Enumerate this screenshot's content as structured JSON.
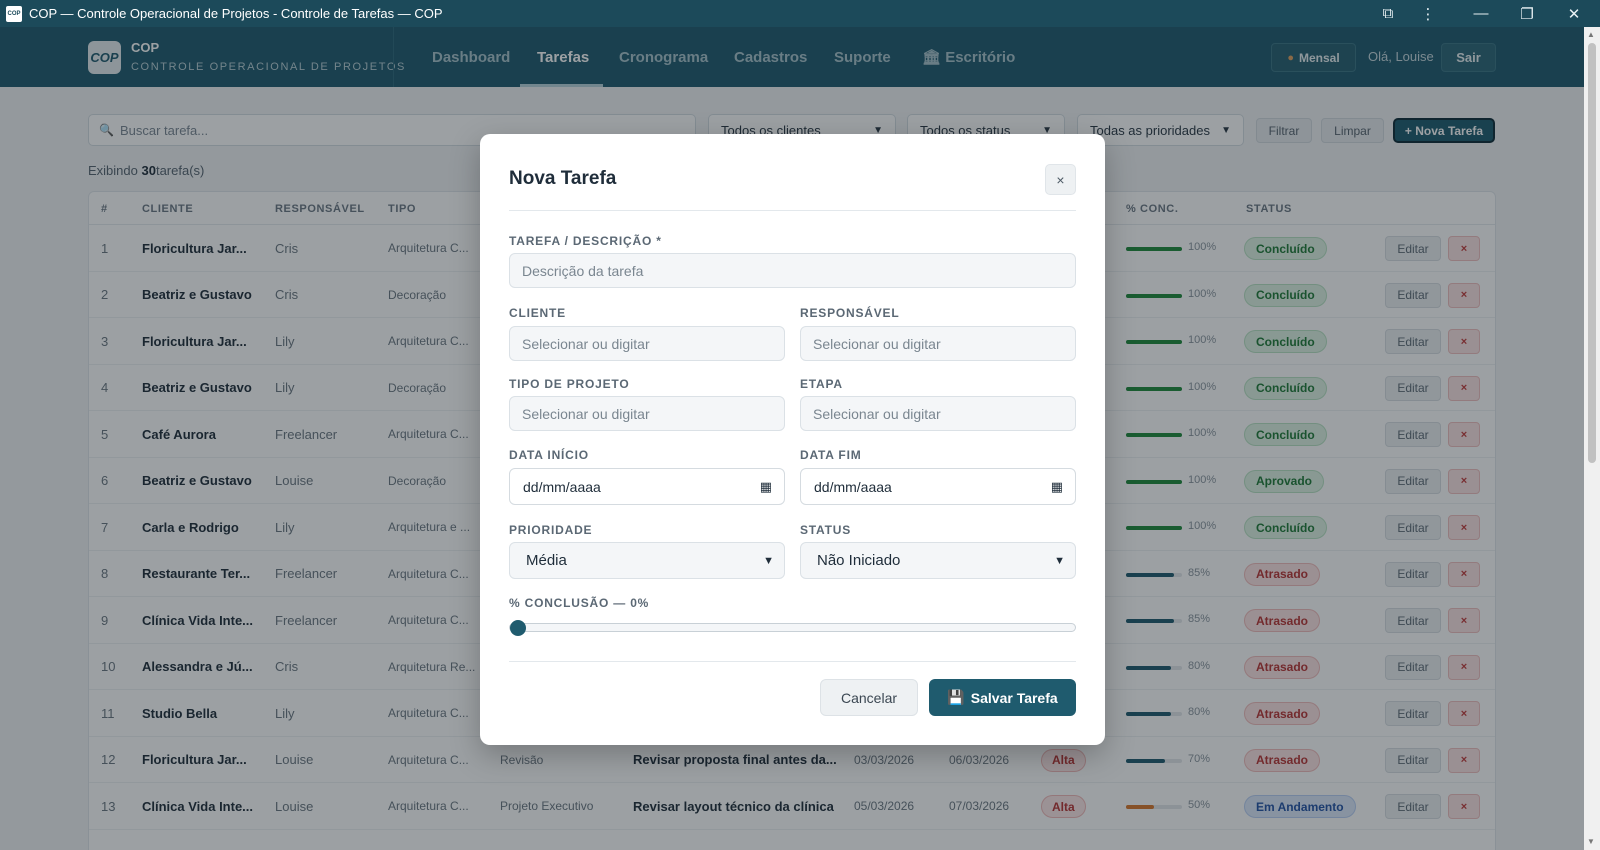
{
  "window": {
    "title": "COP — Controle Operacional de Projetos - Controle de Tarefas — COP",
    "app_icon_text": "COP",
    "controls": [
      "⧉",
      "⋮",
      "—",
      "❐",
      "✕"
    ]
  },
  "navbar": {
    "logo_text": "COP",
    "brand_title": "COP",
    "brand_subtitle": "CONTROLE OPERACIONAL DE PROJETOS",
    "items": [
      {
        "label": "Dashboard"
      },
      {
        "label": "Tarefas"
      },
      {
        "label": "Cronograma"
      },
      {
        "label": "Cadastros"
      },
      {
        "label": "Suporte"
      },
      {
        "label": "🏛 Escritório"
      }
    ],
    "mensal_label": "Mensal",
    "greeting": "Olá, Louise",
    "logout_label": "Sair"
  },
  "filters": {
    "search_placeholder": "Buscar tarefa...",
    "client_select": "Todos os clientes",
    "status_select": "Todos os status",
    "priority_select": "Todas as prioridades",
    "filter_label": "Filtrar",
    "clear_label": "Limpar",
    "new_task_label": "+ Nova Tarefa"
  },
  "count": {
    "prefix": "Exibindo",
    "number": "30",
    "suffix": "tarefa(s)"
  },
  "table": {
    "headers": [
      "#",
      "CLIENTE",
      "RESPONSÁVEL",
      "TIPO",
      "% CONC.",
      "STATUS"
    ],
    "edit_label": "Editar",
    "delete_label": "×",
    "rows": [
      {
        "n": "1",
        "client": "Floricultura Jar...",
        "resp": "Cris",
        "type": "Arquitetura C...",
        "pct": "100%",
        "progress": 1.0,
        "status": "Concluído"
      },
      {
        "n": "2",
        "client": "Beatriz e Gustavo",
        "resp": "Cris",
        "type": "Decoração",
        "pct": "100%",
        "progress": 1.0,
        "status": "Concluído"
      },
      {
        "n": "3",
        "client": "Floricultura Jar...",
        "resp": "Lily",
        "type": "Arquitetura C...",
        "pct": "100%",
        "progress": 1.0,
        "status": "Concluído"
      },
      {
        "n": "4",
        "client": "Beatriz e Gustavo",
        "resp": "Lily",
        "type": "Decoração",
        "pct": "100%",
        "progress": 1.0,
        "status": "Concluído"
      },
      {
        "n": "5",
        "client": "Café Aurora",
        "resp": "Freelancer",
        "type": "Arquitetura C...",
        "pct": "100%",
        "progress": 1.0,
        "status": "Concluído"
      },
      {
        "n": "6",
        "client": "Beatriz e Gustavo",
        "resp": "Louise",
        "type": "Decoração",
        "pct": "100%",
        "progress": 1.0,
        "status": "Aprovado"
      },
      {
        "n": "7",
        "client": "Carla e Rodrigo",
        "resp": "Lily",
        "type": "Arquitetura e ...",
        "pct": "100%",
        "progress": 1.0,
        "status": "Concluído"
      },
      {
        "n": "8",
        "client": "Restaurante Ter...",
        "resp": "Freelancer",
        "type": "Arquitetura C...",
        "pct": "85%",
        "progress": 0.85,
        "status": "Atrasado"
      },
      {
        "n": "9",
        "client": "Clínica Vida Inte...",
        "resp": "Freelancer",
        "type": "Arquitetura C...",
        "pct": "85%",
        "progress": 0.85,
        "status": "Atrasado"
      },
      {
        "n": "10",
        "client": "Alessandra e Jú...",
        "resp": "Cris",
        "type": "Arquitetura Re...",
        "pct": "80%",
        "progress": 0.8,
        "status": "Atrasado"
      },
      {
        "n": "11",
        "client": "Studio Bella",
        "resp": "Lily",
        "type": "Arquitetura C...",
        "pct": "80%",
        "progress": 0.8,
        "status": "Atrasado"
      },
      {
        "n": "12",
        "client": "Floricultura Jar...",
        "resp": "Louise",
        "type": "Arquitetura C...",
        "stage": "Revisão",
        "desc": "Revisar proposta final antes da...",
        "start": "03/03/2026",
        "end": "06/03/2026",
        "priority": "Alta",
        "pct": "70%",
        "progress": 0.7,
        "status": "Atrasado"
      },
      {
        "n": "13",
        "client": "Clínica Vida Inte...",
        "resp": "Louise",
        "type": "Arquitetura C...",
        "stage": "Projeto Executivo",
        "desc": "Revisar layout técnico da clínica",
        "start": "05/03/2026",
        "end": "07/03/2026",
        "priority": "Alta",
        "pct": "50%",
        "progress": 0.5,
        "status": "Em Andamento"
      }
    ],
    "colors": {
      "green": "#1f8a3b",
      "blue": "#1f5b6e",
      "orange": "#d9772b"
    }
  },
  "modal": {
    "title": "Nova Tarefa",
    "close_label": "×",
    "desc_label": "TAREFA / DESCRIÇÃO *",
    "desc_placeholder": "Descrição da tarefa",
    "client_label": "CLIENTE",
    "client_placeholder": "Selecionar ou digitar",
    "resp_label": "RESPONSÁVEL",
    "resp_placeholder": "Selecionar ou digitar",
    "type_label": "TIPO DE PROJETO",
    "type_placeholder": "Selecionar ou digitar",
    "stage_label": "ETAPA",
    "stage_placeholder": "Selecionar ou digitar",
    "start_label": "DATA INÍCIO",
    "start_value": "dd/mm/aaaa",
    "end_label": "DATA FIM",
    "end_value": "dd/mm/aaaa",
    "priority_label": "PRIORIDADE",
    "priority_value": "Média",
    "status_label": "STATUS",
    "status_value": "Não Iniciado",
    "progress_label": "% CONCLUSÃO — 0%",
    "progress_value": 0,
    "cancel_label": "Cancelar",
    "save_label": "Salvar Tarefa"
  }
}
